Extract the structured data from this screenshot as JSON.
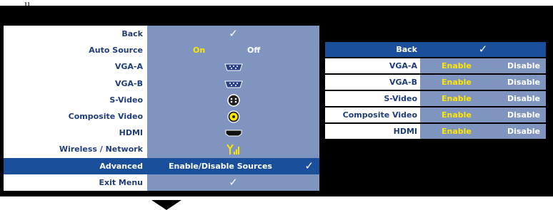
{
  "caption": "ıı        .  , ,   , ,  ",
  "menu": {
    "rows": [
      {
        "label": "Back"
      },
      {
        "label": "Auto Source",
        "on": "On",
        "off": "Off"
      },
      {
        "label": "VGA-A"
      },
      {
        "label": "VGA-B"
      },
      {
        "label": "S-Video"
      },
      {
        "label": "Composite Video"
      },
      {
        "label": "HDMI"
      },
      {
        "label": "Wireless / Network"
      },
      {
        "label": "Advanced",
        "value": "Enable/Disable Sources"
      },
      {
        "label": "Exit Menu"
      }
    ],
    "check": "✓",
    "selected_index": 8
  },
  "submenu": {
    "header": "Back",
    "rows": [
      {
        "label": "VGA-A",
        "enable": "Enable",
        "disable": "Disable"
      },
      {
        "label": "VGA-B",
        "enable": "Enable",
        "disable": "Disable"
      },
      {
        "label": "S-Video",
        "enable": "Enable",
        "disable": "Disable"
      },
      {
        "label": "Composite Video",
        "enable": "Enable",
        "disable": "Disable"
      },
      {
        "label": "HDMI",
        "enable": "Enable",
        "disable": "Disable"
      }
    ]
  },
  "colors": {
    "selected": "#1a4f9c",
    "value_bg": "#7f95bf",
    "label_text": "#1f3d7a",
    "highlight": "#ffe600"
  }
}
